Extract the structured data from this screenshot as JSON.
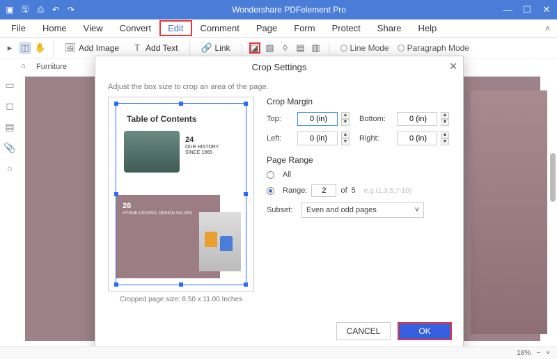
{
  "app": {
    "title": "Wondershare PDFelement Pro"
  },
  "menu": {
    "items": [
      "File",
      "Home",
      "View",
      "Convert",
      "Edit",
      "Comment",
      "Page",
      "Form",
      "Protect",
      "Share",
      "Help"
    ],
    "highlighted": "Edit"
  },
  "toolbar": {
    "add_image": "Add Image",
    "add_text": "Add Text",
    "link": "Link",
    "line_mode": "Line Mode",
    "paragraph_mode": "Paragraph Mode"
  },
  "breadcrumb": {
    "doc": "Furniture"
  },
  "dialog": {
    "title": "Crop Settings",
    "hint": "Adjust the box size to crop an area of the page.",
    "preview_caption": "Cropped page size: 8.50 x 11.00 Inches",
    "page_preview": {
      "title": "Table of Contents",
      "entry1_num": "24",
      "entry1_title": "OUR HISTORY SINCE 1965",
      "entry2_num": "26",
      "entry2_title": "HYGGE-CENTRIC DESIGN VALUES"
    },
    "crop_margin": {
      "label": "Crop Margin",
      "top_label": "Top:",
      "top_value": "0 (in)",
      "bottom_label": "Bottom:",
      "bottom_value": "0 (in)",
      "left_label": "Left:",
      "left_value": "0 (in)",
      "right_label": "Right:",
      "right_value": "0 (in)"
    },
    "page_range": {
      "label": "Page Range",
      "all": "All",
      "range_label": "Range:",
      "range_value": "2",
      "of_label": "of",
      "total": "5",
      "example": "e.g.(1,3,5,7-10)",
      "subset_label": "Subset:",
      "subset_value": "Even and odd pages"
    },
    "buttons": {
      "cancel": "CANCEL",
      "ok": "OK"
    }
  },
  "status": {
    "zoom": "18%"
  }
}
